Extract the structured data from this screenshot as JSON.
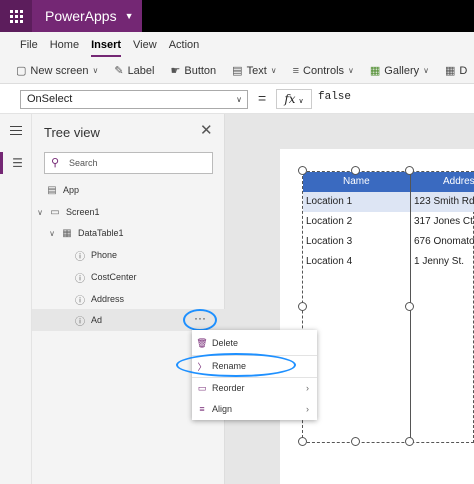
{
  "app": {
    "title": "PowerApps"
  },
  "menu": {
    "items": [
      "File",
      "Home",
      "Insert",
      "View",
      "Action"
    ],
    "active": "Insert"
  },
  "ribbon": {
    "new_screen": "New screen",
    "label": "Label",
    "button": "Button",
    "text": "Text",
    "controls": "Controls",
    "gallery": "Gallery",
    "cut_off": "D"
  },
  "formula": {
    "property": "OnSelect",
    "fx": "fx",
    "value": "false"
  },
  "tree": {
    "title": "Tree view",
    "search_placeholder": "Search",
    "app": "App",
    "screen": "Screen1",
    "table": "DataTable1",
    "fields": [
      "Phone",
      "CostCenter",
      "Address",
      "Ad"
    ],
    "more": "···"
  },
  "context_menu": {
    "delete": "Delete",
    "rename": "Rename",
    "reorder": "Reorder",
    "align": "Align"
  },
  "datatable": {
    "headers": [
      "Name",
      "Addres"
    ],
    "rows": [
      [
        "Location 1",
        "123 Smith Rd."
      ],
      [
        "Location 2",
        "317 Jones Ct."
      ],
      [
        "Location 3",
        "676 Onomato"
      ],
      [
        "Location 4",
        "1 Jenny St."
      ]
    ],
    "header_color": "#3a6ac0"
  },
  "colors": {
    "brand": "#742774",
    "highlight_ring": "#1e90ff"
  }
}
